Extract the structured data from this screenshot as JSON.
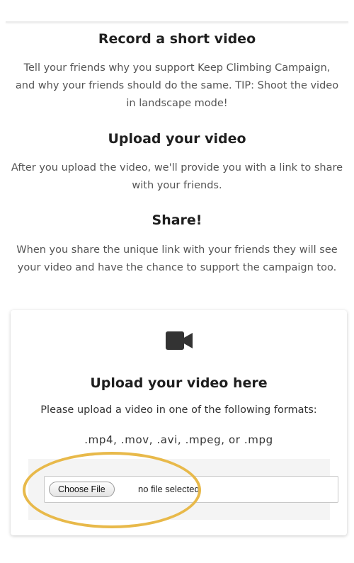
{
  "sections": [
    {
      "heading": "Record a short video",
      "lines": [
        "Tell your friends why you support Keep Climbing Campaign,",
        "and why your friends should do the same. TIP: Shoot the video",
        "in landscape mode!"
      ]
    },
    {
      "heading": "Upload your video",
      "lines": [
        "After you upload the video, we'll provide you with a link to share",
        "with your friends."
      ]
    },
    {
      "heading": "Share!",
      "lines": [
        "When you share the unique link with your friends they will see",
        "your video and have the chance to support the campaign too."
      ]
    }
  ],
  "upload_card": {
    "icon": "video-camera-icon",
    "title": "Upload your video here",
    "instructions": "Please upload a video in one of the following formats:",
    "formats": ".mp4, .mov, .avi, .mpeg, or .mpg",
    "file_input": {
      "button_label": "Choose File",
      "status": "no file selected"
    }
  },
  "colors": {
    "highlight_ring": "#e8b94a",
    "heading_text": "#1f1f1f",
    "body_text": "#555555"
  }
}
